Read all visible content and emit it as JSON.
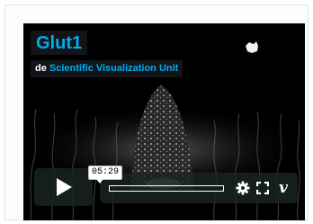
{
  "video": {
    "title": "Glut1",
    "byline_prefix": "de",
    "author": "Scientific Visualization Unit"
  },
  "controls": {
    "timecode": "05:29",
    "progress_fraction": 0,
    "logo": "v"
  },
  "icons": [
    "play-icon",
    "gear-icon",
    "fullscreen-icon",
    "vimeo-logo-icon"
  ],
  "colors": {
    "accent": "#00adef",
    "control_bg": "#172322",
    "video_bg": "#000000"
  }
}
